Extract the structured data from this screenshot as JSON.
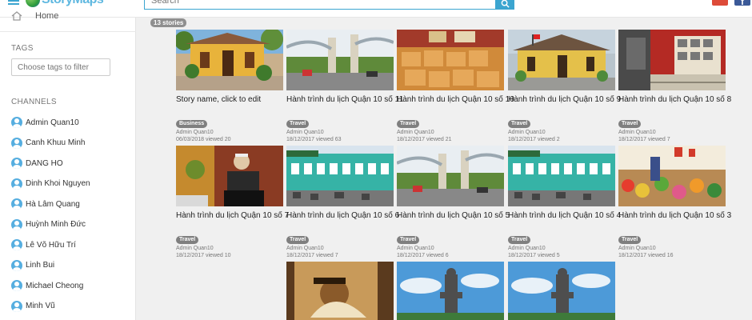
{
  "header": {
    "logo_text": "StoryMaps",
    "search_placeholder": "Search"
  },
  "sidebar": {
    "home_label": "Home",
    "tags_label": "TAGS",
    "tags_placeholder": "Choose tags to filter",
    "channels_label": "CHANNELS",
    "channels": [
      "Admin Quan10",
      "Canh Khuu Minh",
      "DANG HO",
      "Dinh Khoi Nguyen",
      "Hà Lâm Quang",
      "Huỳnh Minh Đức",
      "Lê Võ Hữu Trí",
      "Linh Bui",
      "Michael Cheong",
      "Minh Vũ"
    ]
  },
  "main": {
    "count": "13 stories",
    "stories": [
      {
        "title": "Story name, click to edit",
        "tag": "Business",
        "author": "Admin Quan10",
        "date": "06/03/2018",
        "views": "viewed 20",
        "img": "house"
      },
      {
        "title": "Hành trình du lịch Quận 10 số 11",
        "tag": "Travel",
        "author": "Admin Quan10",
        "date": "18/12/2017",
        "views": "viewed 63",
        "img": "gate"
      },
      {
        "title": "Hành trình du lịch Quận 10 số 10",
        "tag": "Travel",
        "author": "Admin Quan10",
        "date": "18/12/2017",
        "views": "viewed 21",
        "img": "baskets"
      },
      {
        "title": "Hành trình du lịch Quận 10 số 9",
        "tag": "Travel",
        "author": "Admin Quan10",
        "date": "18/12/2017",
        "views": "viewed 2",
        "img": "yellowhouse"
      },
      {
        "title": "Hành trình du lịch Quận 10 số 8",
        "tag": "Travel",
        "author": "Admin Quan10",
        "date": "18/12/2017",
        "views": "viewed 7",
        "img": "museum"
      },
      {
        "title": "Hành trình du lịch Quận 10 số 7",
        "tag": "Travel",
        "author": "Admin Quan10",
        "date": "18/12/2017",
        "views": "viewed 10",
        "img": "man"
      },
      {
        "title": "Hành trình du lịch Quận 10 số 6",
        "tag": "Travel",
        "author": "Admin Quan10",
        "date": "18/12/2017",
        "views": "viewed 7",
        "img": "tealbuilding"
      },
      {
        "title": "Hành trình du lịch Quận 10 số 5",
        "tag": "Travel",
        "author": "Admin Quan10",
        "date": "18/12/2017",
        "views": "viewed 6",
        "img": "gate"
      },
      {
        "title": "Hành trình du lịch Quận 10 số 4",
        "tag": "Travel",
        "author": "Admin Quan10",
        "date": "18/12/2017",
        "views": "viewed 5",
        "img": "tealbuilding"
      },
      {
        "title": "Hành trình du lịch Quận 10 số 3",
        "tag": "Travel",
        "author": "Admin Quan10",
        "date": "18/12/2017",
        "views": "viewed 16",
        "img": "market"
      },
      {
        "title": "",
        "tag": "",
        "author": "",
        "date": "",
        "views": "",
        "img": "painting"
      },
      {
        "title": "",
        "tag": "",
        "author": "",
        "date": "",
        "views": "",
        "img": "statue"
      },
      {
        "title": "",
        "tag": "",
        "author": "",
        "date": "",
        "views": "",
        "img": "statue"
      }
    ]
  }
}
